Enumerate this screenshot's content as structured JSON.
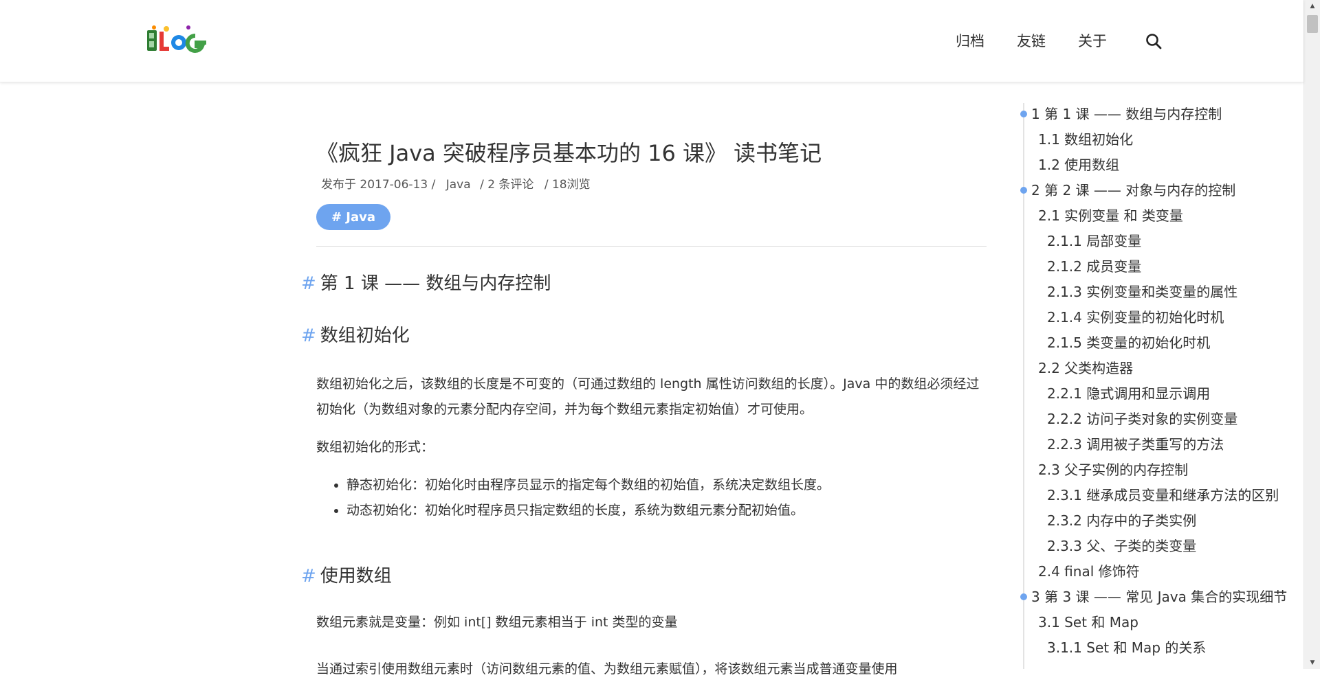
{
  "header": {
    "logo_text": "BLOG",
    "nav": [
      "归档",
      "友链",
      "关于"
    ],
    "search_icon": "search-icon"
  },
  "post": {
    "title": "《疯狂 Java 突破程序员基本功的 16 课》 读书笔记",
    "meta": {
      "published": "发布于 2017-06-13 /",
      "category": "Java",
      "comments": "/  2 条评论",
      "views": "/ 18浏览"
    },
    "tag": "# Java"
  },
  "content": {
    "h1_lesson1": "第 1 课 —— 数组与内存控制",
    "h2_init": "数组初始化",
    "p_init_1": "数组初始化之后，该数组的长度是不可变的（可通过数组的 length 属性访问数组的长度）。Java 中的数组必须经过初始化（为数组对象的元素分配内存空间，并为每个数组元素指定初始值）才可使用。",
    "p_init_2": "数组初始化的形式：",
    "bullets": [
      "静态初始化：初始化时由程序员显示的指定每个数组的初始值，系统决定数组长度。",
      "动态初始化：初始化时程序员只指定数组的长度，系统为数组元素分配初始值。"
    ],
    "h2_use": "使用数组",
    "p_use_1": "数组元素就是变量：例如 int[] 数组元素相当于 int 类型的变量",
    "p_use_2": "当通过索引使用数组元素时（访问数组元素的值、为数组元素赋值），将该数组元素当成普通变量使用"
  },
  "toc": [
    {
      "label": "1 第 1 课 —— 数组与内存控制",
      "level": 1
    },
    {
      "label": "1.1 数组初始化",
      "level": 2
    },
    {
      "label": "1.2 使用数组",
      "level": 2
    },
    {
      "label": "2 第 2 课 —— 对象与内存的控制",
      "level": 1
    },
    {
      "label": "2.1 实例变量 和 类变量",
      "level": 2
    },
    {
      "label": "2.1.1 局部变量",
      "level": 3
    },
    {
      "label": "2.1.2 成员变量",
      "level": 3
    },
    {
      "label": "2.1.3 实例变量和类变量的属性",
      "level": 3
    },
    {
      "label": "2.1.4 实例变量的初始化时机",
      "level": 3
    },
    {
      "label": "2.1.5 类变量的初始化时机",
      "level": 3
    },
    {
      "label": "2.2 父类构造器",
      "level": 2
    },
    {
      "label": "2.2.1 隐式调用和显示调用",
      "level": 3
    },
    {
      "label": "2.2.2 访问子类对象的实例变量",
      "level": 3
    },
    {
      "label": "2.2.3 调用被子类重写的方法",
      "level": 3
    },
    {
      "label": "2.3 父子实例的内存控制",
      "level": 2
    },
    {
      "label": "2.3.1 继承成员变量和继承方法的区别",
      "level": 3
    },
    {
      "label": "2.3.2 内存中的子类实例",
      "level": 3
    },
    {
      "label": "2.3.3 父、子类的类变量",
      "level": 3
    },
    {
      "label": "2.4 final 修饰符",
      "level": 2
    },
    {
      "label": "3 第 3 课 —— 常见 Java 集合的实现细节",
      "level": 1
    },
    {
      "label": "3.1 Set 和 Map",
      "level": 2
    },
    {
      "label": "3.1.1 Set 和 Map 的关系",
      "level": 3
    }
  ],
  "colors": {
    "accent": "#6ea4ef",
    "text": "#333333",
    "divider": "#dcdcdc"
  }
}
